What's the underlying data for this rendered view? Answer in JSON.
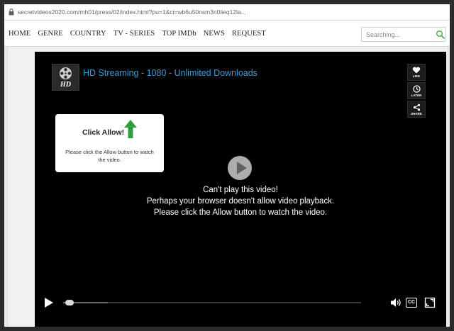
{
  "browser": {
    "url": "secretvideos2020.com/mh01/press/02/index.html?pu=1&ci=wb6u50nsm3n0ileq12la..."
  },
  "nav": {
    "items": [
      "HOME",
      "GENRE",
      "COUNTRY",
      "TV - SERIES",
      "TOP IMDb",
      "NEWS",
      "REQUEST"
    ],
    "search_placeholder": "Searching..."
  },
  "player": {
    "logo_text": "HD",
    "title": "HD Streaming - 1080 - Unlimited Downloads",
    "side_buttons": [
      {
        "icon": "heart-icon",
        "label": "LIKE"
      },
      {
        "icon": "clock-icon",
        "label": "LATER"
      },
      {
        "icon": "share-icon",
        "label": "SHARE"
      }
    ],
    "popup": {
      "title": "Click Allow!",
      "text": "Please click the Allow button to watch the video."
    },
    "message_line1": "Can't play this video!",
    "message_line2": "Perhaps your browser doesn't allow video playback. Please click the Allow button to watch the video.",
    "cc_label": "CC",
    "buffered_fraction": 0.15
  },
  "colors": {
    "title_blue": "#3d9bd6",
    "arrow_green": "#2e9e3a",
    "search_icon_green": "#4caf50"
  }
}
